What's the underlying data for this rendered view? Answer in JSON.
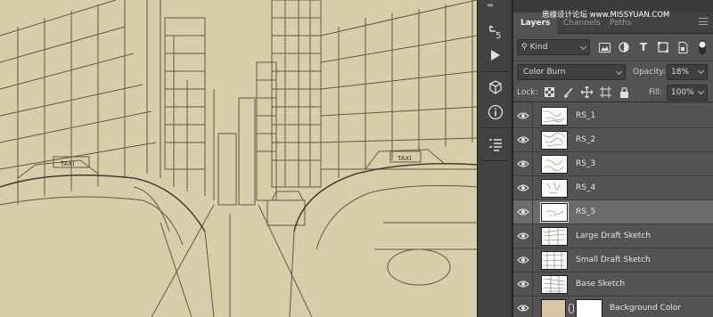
{
  "watermark": "思缘设计论坛 www.MISSYUAN.COM",
  "panel": {
    "tabs": [
      "Layers",
      "Channels",
      "Paths"
    ],
    "filter_kind": "Kind",
    "blend_mode": "Color Burn",
    "opacity_label": "Opacity:",
    "opacity_value": "18%",
    "lock_label": "Lock:",
    "fill_label": "Fill:",
    "fill_value": "100%"
  },
  "layers": [
    {
      "name": "RS_1",
      "selected": false
    },
    {
      "name": "RS_2",
      "selected": false
    },
    {
      "name": "RS_3",
      "selected": false
    },
    {
      "name": "RS_4",
      "selected": false
    },
    {
      "name": "RS_5",
      "selected": true
    },
    {
      "name": "Large Draft Sketch",
      "selected": false
    },
    {
      "name": "Small Draft Sketch",
      "selected": false
    },
    {
      "name": "Base Sketch",
      "selected": false
    },
    {
      "name": "Background Color",
      "selected": false
    }
  ],
  "taxi_sign": "TAXI",
  "colors": {
    "canvas": "#d9cdaa",
    "panel": "#535353",
    "selected_row": "#6b6b6b",
    "background_swatch": "#d8c6a6"
  }
}
